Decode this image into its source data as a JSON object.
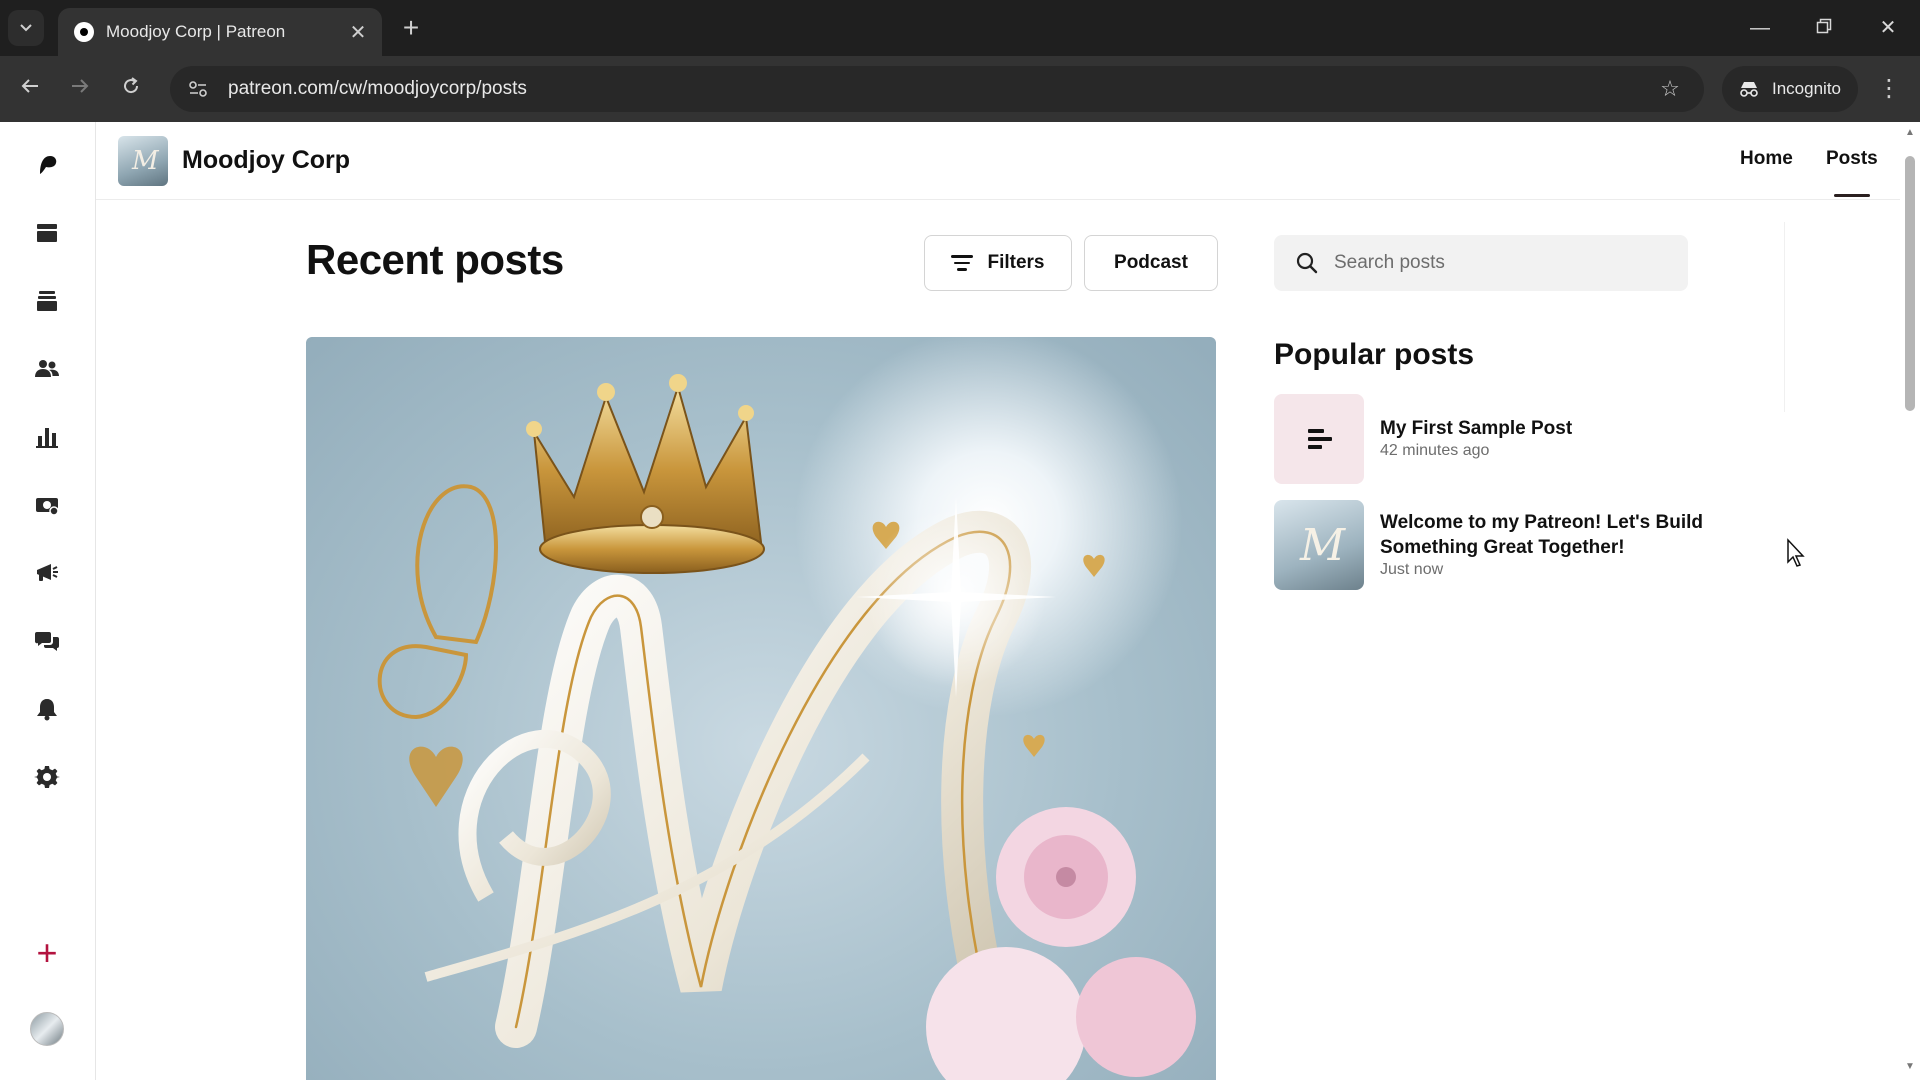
{
  "browser": {
    "tab_title": "Moodjoy Corp | Patreon",
    "url": "patreon.com/cw/moodjoycorp/posts",
    "incognito_label": "Incognito"
  },
  "sidebar": {
    "items": [
      {
        "name": "patreon-logo-icon"
      },
      {
        "name": "dashboard-icon"
      },
      {
        "name": "library-icon"
      },
      {
        "name": "audience-icon"
      },
      {
        "name": "insights-icon"
      },
      {
        "name": "payouts-icon"
      },
      {
        "name": "promotions-icon"
      },
      {
        "name": "chats-icon"
      },
      {
        "name": "notifications-icon"
      },
      {
        "name": "settings-icon"
      }
    ]
  },
  "header": {
    "creator_name": "Moodjoy Corp",
    "nav": [
      {
        "label": "Home",
        "active": false
      },
      {
        "label": "Posts",
        "active": true
      }
    ]
  },
  "main": {
    "section_title": "Recent posts",
    "filters_label": "Filters",
    "podcast_label": "Podcast"
  },
  "right_panel": {
    "search_placeholder": "Search posts",
    "popular_title": "Popular posts",
    "popular_posts": [
      {
        "title": "My First Sample Post",
        "time": "42 minutes ago"
      },
      {
        "title": "Welcome to my Patreon! Let's Build Something Great Together!",
        "time": "Just now"
      }
    ]
  },
  "colors": {
    "accent": "#b3123f",
    "chrome_dark": "#1f1f1f",
    "chrome_toolbar": "#333333",
    "text_thumb_bg": "#f5e6ea"
  }
}
